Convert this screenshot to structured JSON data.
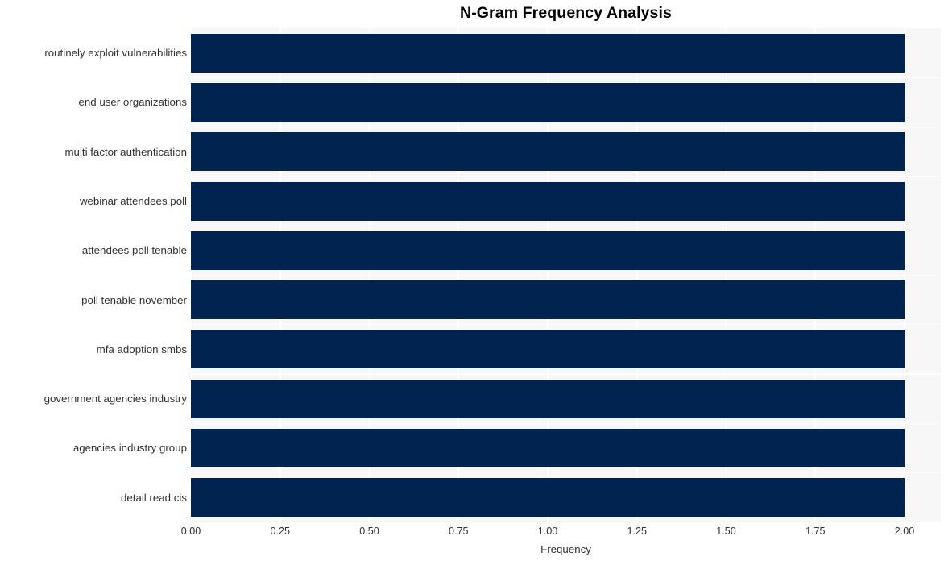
{
  "chart_data": {
    "type": "bar",
    "orientation": "horizontal",
    "title": "N-Gram Frequency Analysis",
    "xlabel": "Frequency",
    "ylabel": "",
    "categories": [
      "routinely exploit vulnerabilities",
      "end user organizations",
      "multi factor authentication",
      "webinar attendees poll",
      "attendees poll tenable",
      "poll tenable november",
      "mfa adoption smbs",
      "government agencies industry",
      "agencies industry group",
      "detail read cis"
    ],
    "values": [
      2,
      2,
      2,
      2,
      2,
      2,
      2,
      2,
      2,
      2
    ],
    "xlim": [
      0.0,
      2.0
    ],
    "xticks": [
      "0.00",
      "0.25",
      "0.50",
      "0.75",
      "1.00",
      "1.25",
      "1.50",
      "1.75",
      "2.00"
    ],
    "xtick_values": [
      0.0,
      0.25,
      0.5,
      0.75,
      1.0,
      1.25,
      1.5,
      1.75,
      2.0
    ],
    "grid": true,
    "legend": null,
    "bar_color": "#00234f",
    "plot_background": "#f7f7f7",
    "gridline_color": "#ffffff",
    "figure_background": "#ffffff",
    "text_color": "#333333",
    "title_color": "#000000"
  }
}
